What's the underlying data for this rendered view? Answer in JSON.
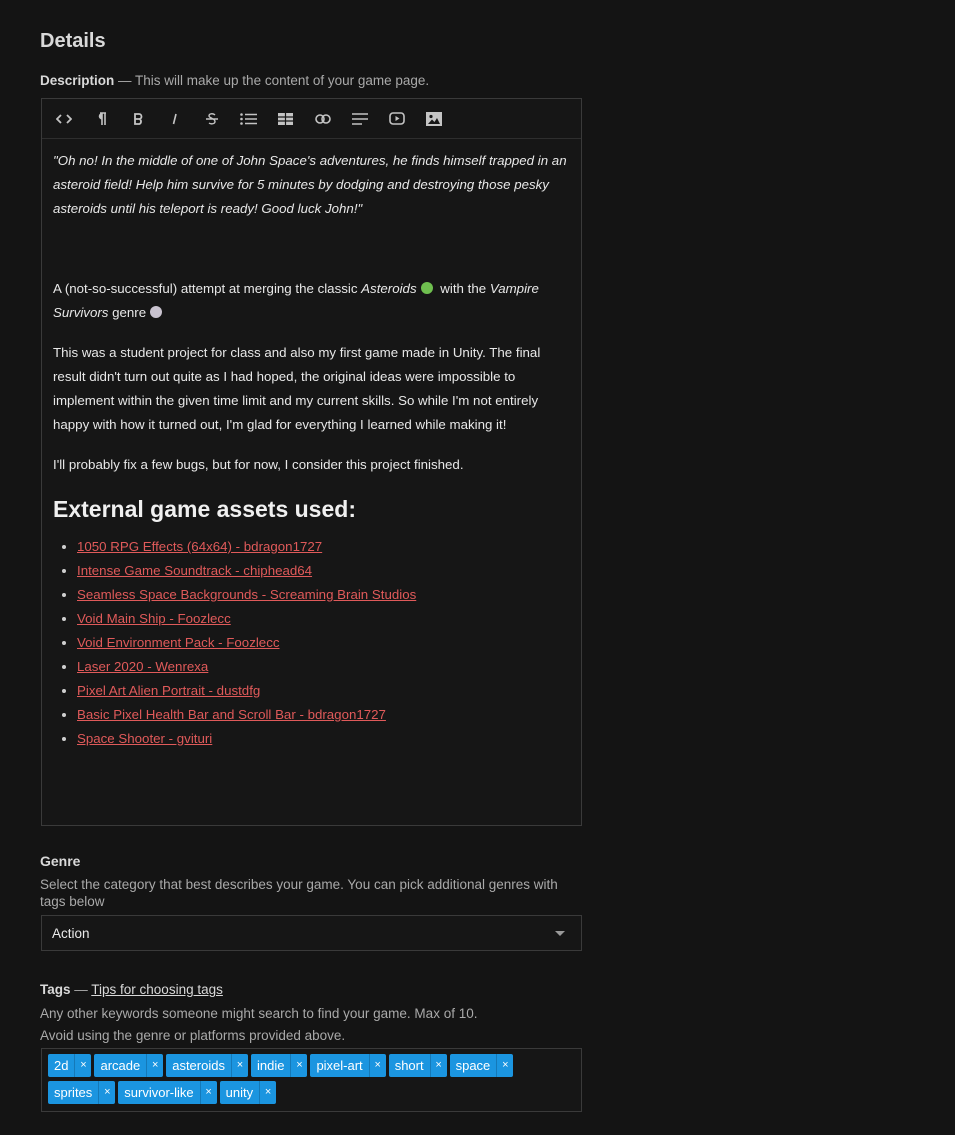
{
  "section": {
    "title": "Details"
  },
  "description": {
    "label": "Description",
    "hint": " — This will make up the content of your game page."
  },
  "toolbar": {
    "buttons": [
      "code-view",
      "paragraph",
      "bold",
      "italic",
      "strikethrough",
      "bullet-list",
      "table",
      "link",
      "align",
      "video",
      "image"
    ]
  },
  "editor": {
    "quote": "\"Oh no! In the middle of one of John Space's adventures, he finds himself trapped in an asteroid field! Help him survive for 5 minutes by dodging and destroying those pesky asteroids until his teleport is ready! Good luck John!\"",
    "p1_a": "A (not-so-successful) attempt at merging the classic ",
    "p1_b": "Asteroids",
    "p1_c": " with the ",
    "p1_d": "Vampire Survivors",
    "p1_e": " genre",
    "p2": "This was a student project for class and also my first game made in Unity. The final result didn't turn out quite as I had hoped, the original ideas were impossible to implement within the given time limit and my current skills. So while I'm not entirely happy with how it turned out, I'm glad for everything I learned while making it!",
    "p3": "I'll probably fix a few bugs, but for now, I consider this project finished.",
    "heading": "External game assets used:",
    "assets": [
      "1050 RPG Effects (64x64) - bdragon1727",
      "Intense Game Soundtrack - chiphead64",
      "Seamless Space Backgrounds - Screaming Brain Studios",
      "Void Main Ship - Foozlecc",
      "Void Environment Pack - Foozlecc",
      "Laser 2020 - Wenrexa",
      "Pixel Art Alien Portrait - dustdfg",
      "Basic Pixel Health Bar and Scroll Bar - bdragon1727",
      "Space Shooter - gvituri"
    ],
    "emoji_colors": {
      "alien": "#6fbf4f",
      "vampire": "#c9c3cf"
    }
  },
  "genre": {
    "title": "Genre",
    "description": "Select the category that best describes your game. You can pick additional genres with tags below",
    "selected": "Action"
  },
  "tags": {
    "title": "Tags",
    "separator": " — ",
    "tips_link": "Tips for choosing tags",
    "desc1": "Any other keywords someone might search to find your game. Max of 10.",
    "desc2": "Avoid using the genre or platforms provided above.",
    "row1": [
      "2d",
      "arcade",
      "asteroids",
      "indie",
      "pixel-art",
      "short",
      "space"
    ],
    "row2": [
      "sprites",
      "survivor-like",
      "unity"
    ],
    "remove_glyph": "×",
    "color": "#1b95e0"
  }
}
